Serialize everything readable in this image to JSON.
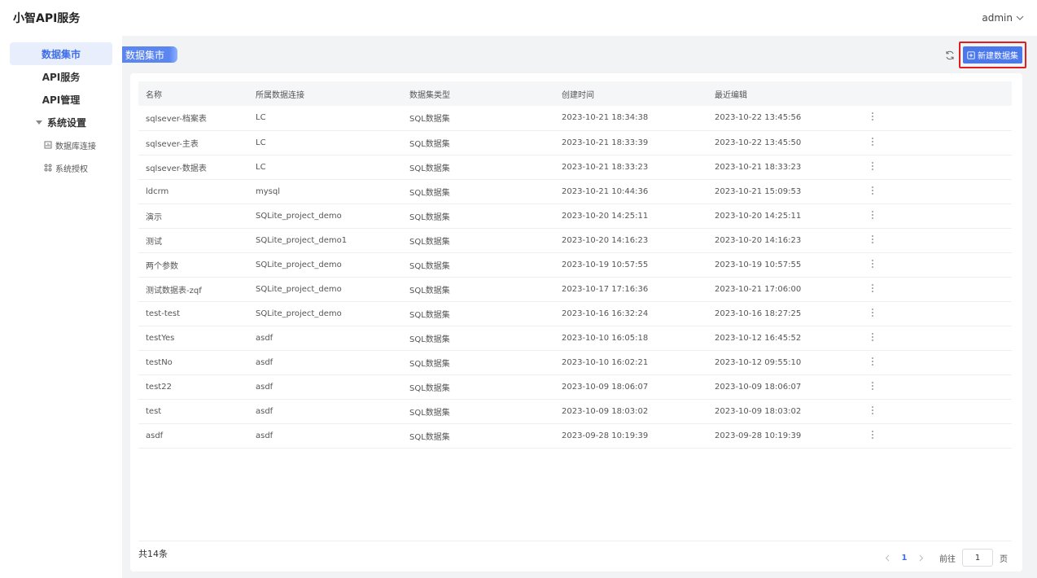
{
  "header": {
    "app_title": "小智API服务",
    "user": "admin"
  },
  "sidebar": {
    "items": [
      {
        "label": "数据集市",
        "active": true
      },
      {
        "label": "API服务"
      },
      {
        "label": "API管理"
      }
    ],
    "group": {
      "label": "系统设置",
      "children": [
        {
          "label": "数据库连接",
          "icon": "database-icon"
        },
        {
          "label": "系统授权",
          "icon": "grid-icon"
        }
      ]
    }
  },
  "main": {
    "breadcrumb": "数据集市",
    "new_button_label": "新建数据集",
    "columns": [
      "名称",
      "所属数据连接",
      "数据集类型",
      "创建时间",
      "最近编辑"
    ],
    "rows": [
      [
        "sqlsever-档案表",
        "LC",
        "SQL数据集",
        "2023-10-21 18:34:38",
        "2023-10-22 13:45:56"
      ],
      [
        "sqlsever-主表",
        "LC",
        "SQL数据集",
        "2023-10-21 18:33:39",
        "2023-10-22 13:45:50"
      ],
      [
        "sqlsever-数据表",
        "LC",
        "SQL数据集",
        "2023-10-21 18:33:23",
        "2023-10-21 18:33:23"
      ],
      [
        "ldcrm",
        "mysql",
        "SQL数据集",
        "2023-10-21 10:44:36",
        "2023-10-21 15:09:53"
      ],
      [
        "演示",
        "SQLite_project_demo",
        "SQL数据集",
        "2023-10-20 14:25:11",
        "2023-10-20 14:25:11"
      ],
      [
        "测试",
        "SQLite_project_demo1",
        "SQL数据集",
        "2023-10-20 14:16:23",
        "2023-10-20 14:16:23"
      ],
      [
        "两个参数",
        "SQLite_project_demo",
        "SQL数据集",
        "2023-10-19 10:57:55",
        "2023-10-19 10:57:55"
      ],
      [
        "测试数据表-zqf",
        "SQLite_project_demo",
        "SQL数据集",
        "2023-10-17 17:16:36",
        "2023-10-21 17:06:00"
      ],
      [
        "test-test",
        "SQLite_project_demo",
        "SQL数据集",
        "2023-10-16 16:32:24",
        "2023-10-16 18:27:25"
      ],
      [
        "testYes",
        "asdf",
        "SQL数据集",
        "2023-10-10 16:05:18",
        "2023-10-12 16:45:52"
      ],
      [
        "testNo",
        "asdf",
        "SQL数据集",
        "2023-10-10 16:02:21",
        "2023-10-12 09:55:10"
      ],
      [
        "test22",
        "asdf",
        "SQL数据集",
        "2023-10-09 18:06:07",
        "2023-10-09 18:06:07"
      ],
      [
        "test",
        "asdf",
        "SQL数据集",
        "2023-10-09 18:03:02",
        "2023-10-09 18:03:02"
      ],
      [
        "asdf",
        "asdf",
        "SQL数据集",
        "2023-09-28 10:19:39",
        "2023-09-28 10:19:39"
      ]
    ],
    "total_label": "共14条",
    "pagination": {
      "current_page": "1",
      "goto_label": "前往",
      "goto_value": "1",
      "page_suffix": "页"
    }
  },
  "colors": {
    "accent": "#4a78ea",
    "highlight_border": "#e11d1d",
    "active_bg": "#e8eefc"
  }
}
